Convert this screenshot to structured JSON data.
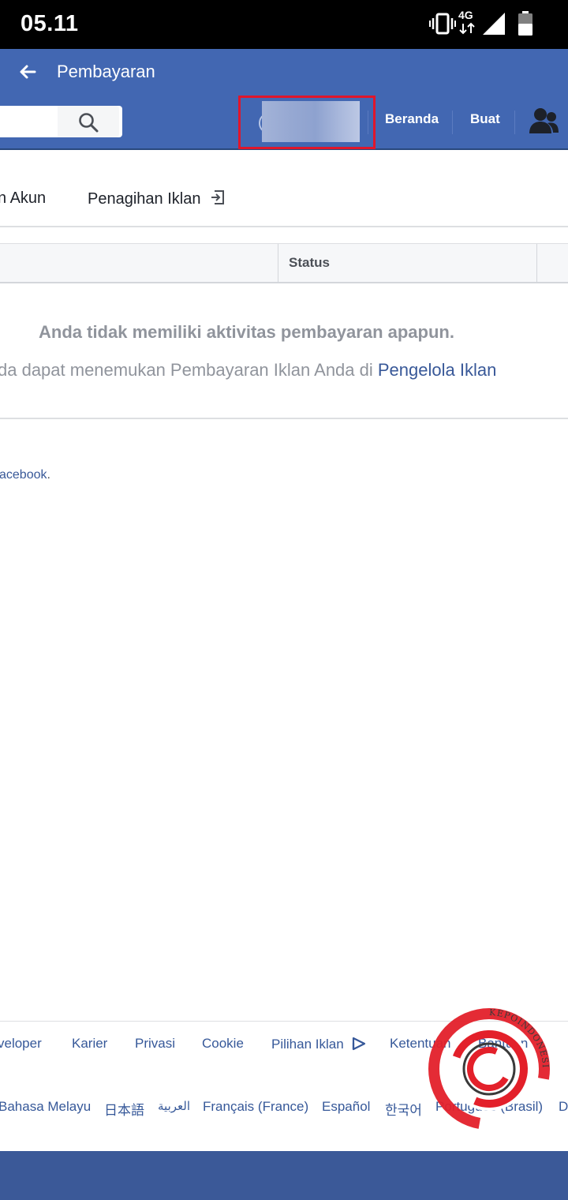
{
  "status_bar": {
    "time": "05.11",
    "network_label": "4G",
    "icons": [
      "vibrate-icon",
      "network-4g-icon",
      "signal-icon",
      "battery-icon"
    ]
  },
  "app_bar": {
    "title": "Pembayaran",
    "back_icon": "arrow-left-icon"
  },
  "header": {
    "search_placeholder": "",
    "search_icon": "search-icon",
    "nav_home": "Beranda",
    "nav_create": "Buat",
    "friends_icon": "friends-icon",
    "highlight_color": "#e0162b"
  },
  "tabs": [
    {
      "label": "n Akun"
    },
    {
      "label": "Penagihan Iklan"
    }
  ],
  "table": {
    "columns": [
      "",
      "Status",
      ""
    ]
  },
  "empty_state": {
    "title": "Anda tidak memiliki aktivitas pembayaran apapun.",
    "subtitle": "da dapat menemukan Pembayaran Iklan Anda di ",
    "link_text": "Pengelola Iklan"
  },
  "note": {
    "link_text": "acebook",
    "suffix": "."
  },
  "footer": {
    "links_row1": [
      "veloper",
      "Karier",
      "Privasi",
      "Cookie",
      "Pilihan Iklan",
      "Ketentuan",
      "Bantuan"
    ],
    "languages": [
      "Bahasa Melayu",
      "日本語",
      "العربية",
      "Français (France)",
      "Español",
      "한국어",
      "Português (Brasil)",
      "D"
    ]
  },
  "watermark": {
    "text": "KEPOINDONESIA"
  },
  "colors": {
    "facebook_blue": "#4267b2",
    "footer_blue": "#3b5998",
    "link_blue": "#385898",
    "watermark_red": "#e3202a"
  }
}
